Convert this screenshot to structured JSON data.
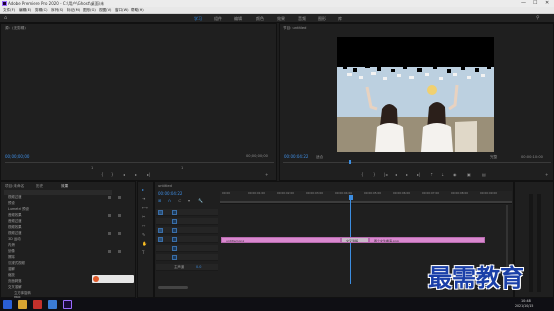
{
  "app": {
    "title": "Adobe Premiere Pro 2020 - C:\\用户\\Ghost\\桌面\\未",
    "window_controls": [
      "—",
      "☐",
      "✕"
    ]
  },
  "menu": [
    "文件(F)",
    "编辑(E)",
    "剪辑(C)",
    "序列(S)",
    "标记(M)",
    "图形(G)",
    "视图(V)",
    "窗口(W)",
    "帮助(H)"
  ],
  "workspaces": [
    "学习",
    "组件",
    "编辑",
    "颜色",
    "效果",
    "音频",
    "图形",
    "库"
  ],
  "source_panel": {
    "title": "源：(无剪辑)",
    "timecode_left": "00;00;00;00",
    "timecode_right": "00;00;00;00",
    "page_left": "1",
    "page_right": "1"
  },
  "program_panel": {
    "title": "节目: untitled",
    "timecode": "00:00:04:22",
    "fit_label": "适合",
    "quality_label": "完整",
    "duration": "00:00:10:00"
  },
  "project_panel": {
    "tabs": [
      "项目:未命名",
      "历史",
      "效果"
    ],
    "tree": [
      "视频过渡",
      "预设",
      "Lumetri 预设",
      "音频效果",
      "音频过渡",
      "视频效果",
      "视频过渡",
      "3D 运动",
      "内滑",
      "划像",
      "擦除",
      "沉浸式视频",
      "溶解",
      "缩放",
      "页面剥落",
      "交叉溶解",
      "立方体旋转",
      "翻转",
      "交叉划像"
    ]
  },
  "timeline": {
    "title": "untitled",
    "timecode": "00:00:04:22",
    "ruler_labels": [
      "00:00",
      "00:00:01:00",
      "00:00:02:00",
      "00:00:03:00",
      "00:00:04:00",
      "00:00:05:00",
      "00:00:06:00",
      "00:00:07:00",
      "00:00:08:00",
      "00:00:09:00"
    ],
    "tracks": [
      "V3",
      "V2",
      "V1",
      "A1",
      "A2",
      "A3"
    ],
    "master_label": "主声道",
    "master_value": "0.0",
    "clips": [
      {
        "label": "untitled.png"
      },
      {
        "label": "交叉溶解"
      },
      {
        "label": "两个女生看海.png"
      }
    ]
  },
  "taskbar": {
    "clock_time": "10:48",
    "clock_date": "2021/10/15"
  },
  "watermark": "最需教育",
  "colors": {
    "accent": "#2d8ceb",
    "clip": "#d988cf",
    "playhead": "#3c8de0"
  }
}
